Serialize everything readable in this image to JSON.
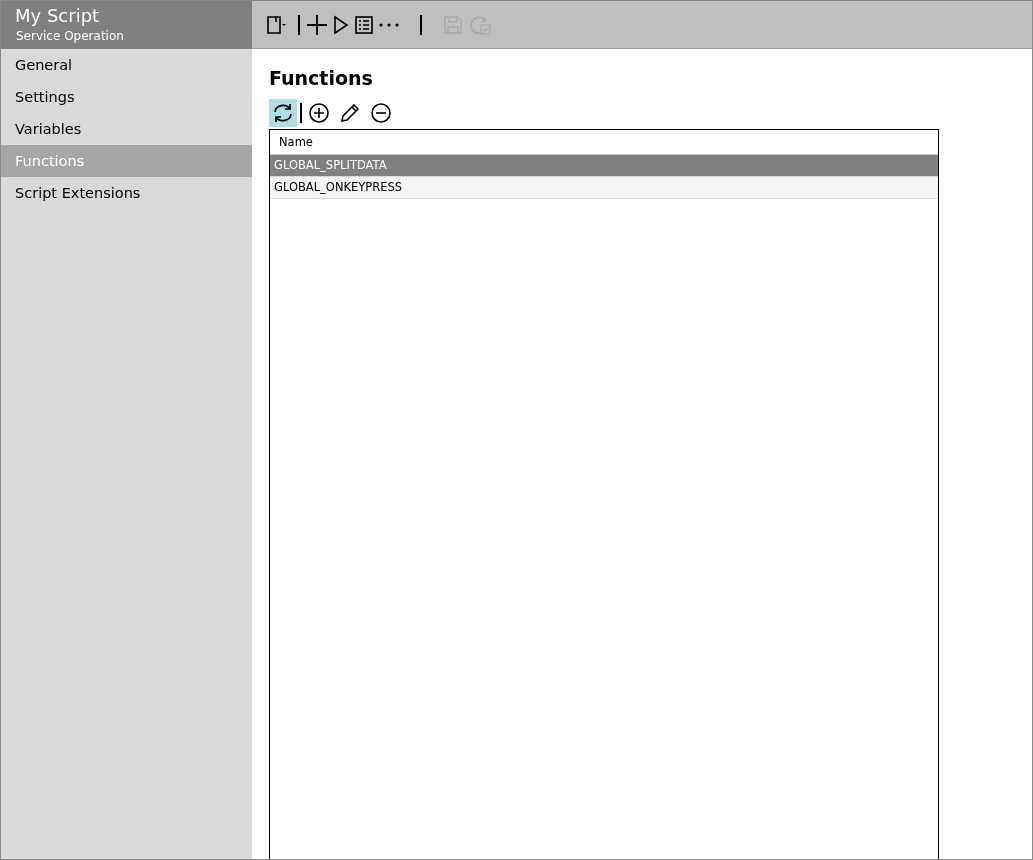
{
  "app": {
    "title": "My Script",
    "subtitle": "Service Operation"
  },
  "sidebar": {
    "items": [
      {
        "label": "General",
        "selected": false
      },
      {
        "label": "Settings",
        "selected": false
      },
      {
        "label": "Variables",
        "selected": false
      },
      {
        "label": "Functions",
        "selected": true
      },
      {
        "label": "Script Extensions",
        "selected": false
      }
    ]
  },
  "toolbar": [
    {
      "kind": "new",
      "disabled": false
    },
    {
      "kind": "separator"
    },
    {
      "kind": "add",
      "disabled": false
    },
    {
      "kind": "run",
      "disabled": false
    },
    {
      "kind": "list",
      "disabled": false
    },
    {
      "kind": "more",
      "disabled": false
    },
    {
      "kind": "separator"
    },
    {
      "kind": "save",
      "disabled": true
    },
    {
      "kind": "reload",
      "disabled": true
    }
  ],
  "section": {
    "title": "Functions"
  },
  "list_toolbar": [
    {
      "kind": "refresh",
      "highlighted": true
    },
    {
      "kind": "separator"
    },
    {
      "kind": "add",
      "highlighted": false
    },
    {
      "kind": "edit",
      "highlighted": false
    },
    {
      "kind": "remove",
      "highlighted": false
    }
  ],
  "table": {
    "columns": [
      "Name"
    ],
    "rows": [
      {
        "cells": [
          "GLOBAL_SPLITDATA"
        ],
        "selected": true
      },
      {
        "cells": [
          "GLOBAL_ONKEYPRESS"
        ],
        "selected": false
      }
    ]
  }
}
